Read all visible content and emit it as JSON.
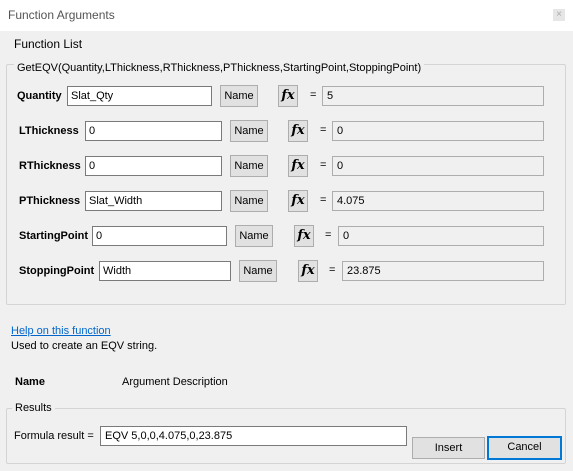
{
  "window": {
    "title": "Function Arguments",
    "close_label": "×"
  },
  "function_list_label": "Function List",
  "signature": "GetEQV(Quantity,LThickness,RThickness,PThickness,StartingPoint,StoppingPoint)",
  "arguments": [
    {
      "label": "Quantity",
      "value": "Slat_Qty",
      "name_button": "Name",
      "fx_label": "fx",
      "equals": "=",
      "result": "5"
    },
    {
      "label": "LThickness",
      "value": "0",
      "name_button": "Name",
      "fx_label": "fx",
      "equals": "=",
      "result": "0"
    },
    {
      "label": "RThickness",
      "value": "0",
      "name_button": "Name",
      "fx_label": "fx",
      "equals": "=",
      "result": "0"
    },
    {
      "label": "PThickness",
      "value": "Slat_Width",
      "name_button": "Name",
      "fx_label": "fx",
      "equals": "=",
      "result": "4.075"
    },
    {
      "label": "StartingPoint",
      "value": "0",
      "name_button": "Name",
      "fx_label": "fx",
      "equals": "=",
      "result": "0"
    },
    {
      "label": "StoppingPoint",
      "value": "Width",
      "name_button": "Name",
      "fx_label": "fx",
      "equals": "=",
      "result": "23.875"
    }
  ],
  "help_link": "Help on this function",
  "description": "Used to create an EQV string.",
  "name_header": "Name",
  "argument_description_header": "Argument Description",
  "results": {
    "group_label": "Results",
    "formula_label": "Formula result =",
    "formula_value": "EQV 5,0,0,4.075,0,23.875"
  },
  "buttons": {
    "insert": "Insert",
    "cancel": "Cancel"
  }
}
